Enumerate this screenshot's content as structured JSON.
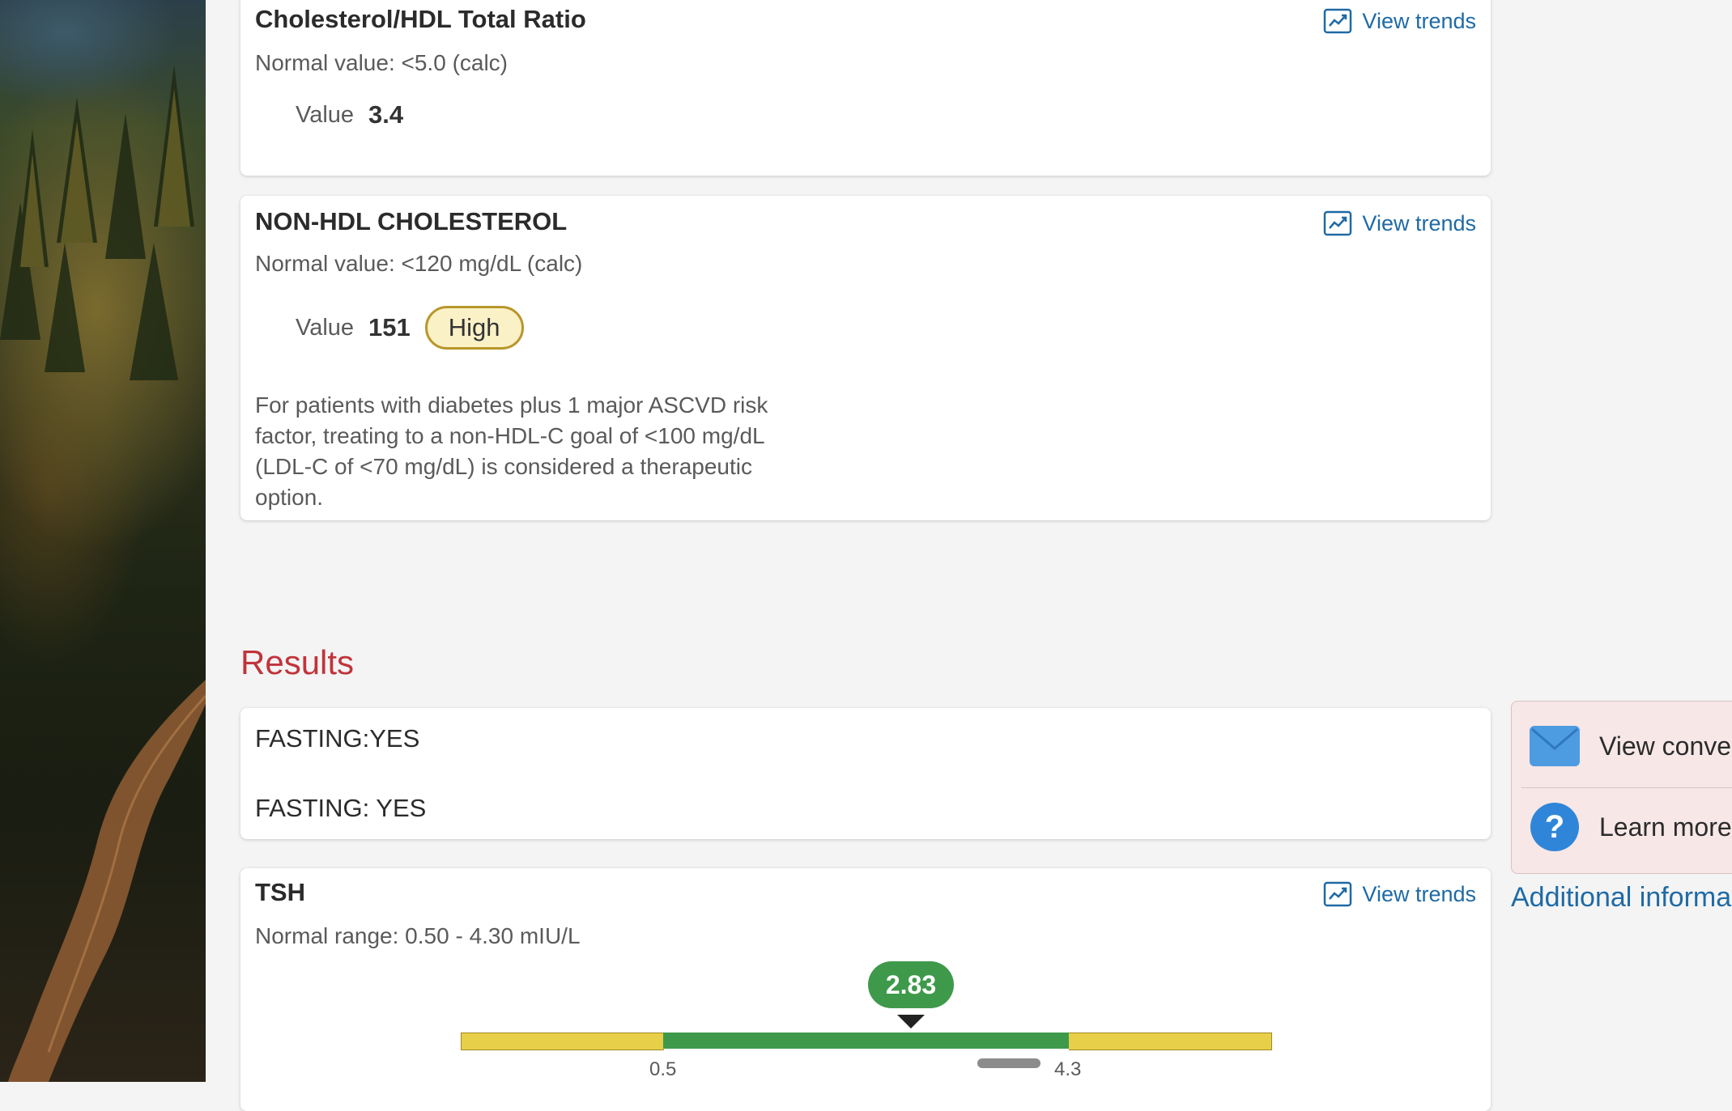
{
  "cards": {
    "ratio": {
      "title": "Cholesterol/HDL Total Ratio",
      "normal": "Normal value: <5.0 (calc)",
      "value_label": "Value",
      "value": "3.4",
      "trends_label": "View trends"
    },
    "nonhdl": {
      "title": "NON-HDL CHOLESTEROL",
      "normal": "Normal value: <120 mg/dL (calc)",
      "value_label": "Value",
      "value": "151",
      "flag": "High",
      "trends_label": "View trends",
      "note": "For patients with diabetes plus 1 major ASCVD risk factor, treating to a non-HDL-C goal of <100 mg/dL (LDL-C of <70 mg/dL) is considered a therapeutic option."
    }
  },
  "results": {
    "heading": "Results",
    "fasting_1": "FASTING:YES",
    "fasting_2": "FASTING: YES"
  },
  "tsh": {
    "title": "TSH",
    "normal": "Normal range: 0.50 - 4.30 mIU/L",
    "trends_label": "View trends",
    "value": "2.83",
    "range_low": "0.5",
    "range_high": "4.3"
  },
  "side_panel": {
    "conversation_label": "View conve",
    "learn_label": "Learn more",
    "additional_label": "Additional informa"
  },
  "icons": {
    "trends": "chart-line-icon",
    "mail": "envelope-icon",
    "help": "question-circle-icon"
  },
  "colors": {
    "link": "#1f6aa5",
    "results_heading": "#c0343a",
    "normal_green": "#3e9a4a",
    "out_of_range_yellow": "#e8cf4a",
    "high_badge_border": "#b8962a"
  }
}
